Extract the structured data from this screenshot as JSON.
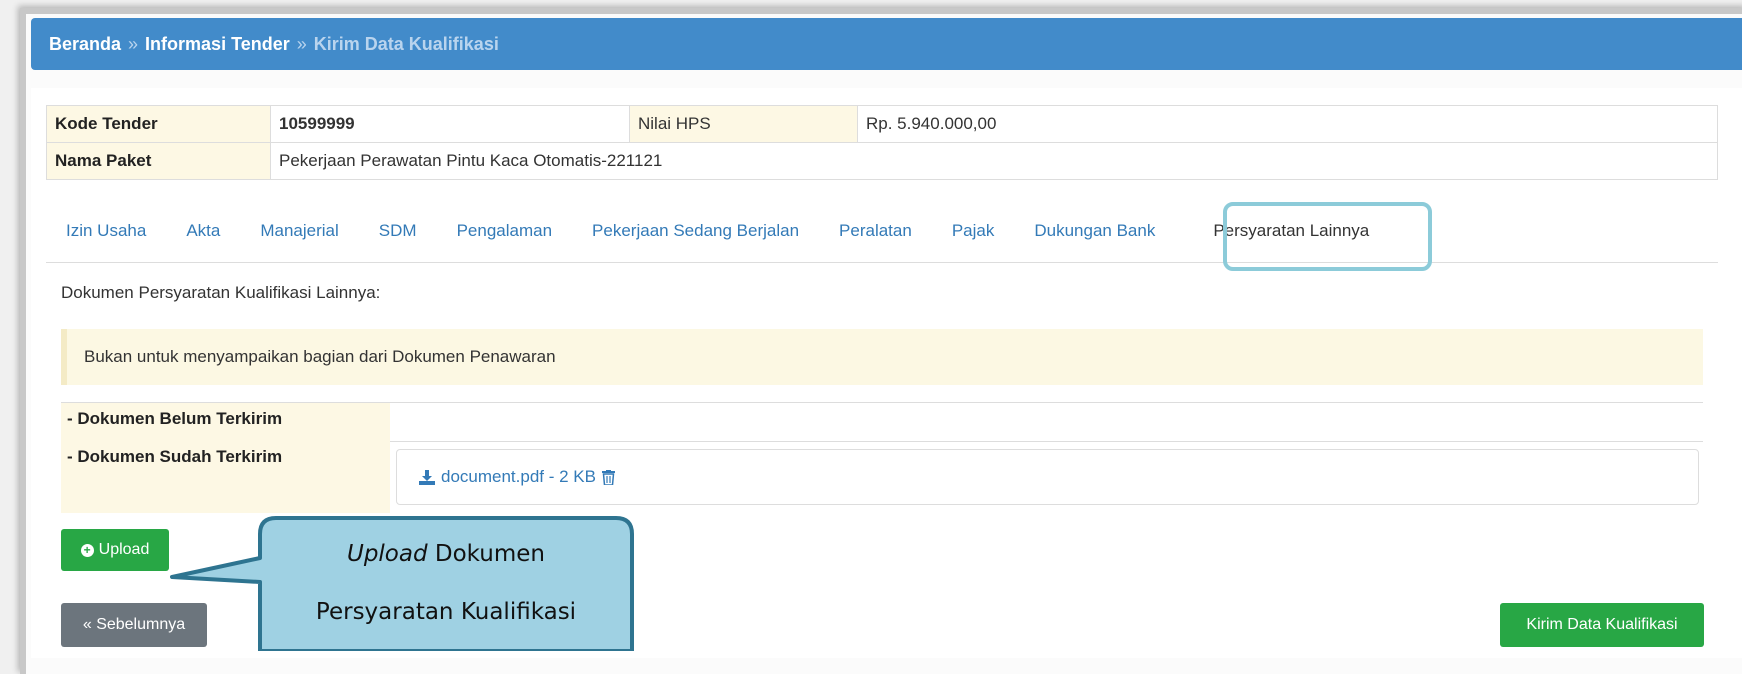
{
  "breadcrumb": {
    "home": "Beranda",
    "separator": "»",
    "info": "Informasi Tender",
    "current": "Kirim Data Kualifikasi"
  },
  "info_table": {
    "kode_label": "Kode Tender",
    "kode_value": "10599999",
    "hps_label": "Nilai HPS",
    "hps_value": "Rp. 5.940.000,00",
    "paket_label": "Nama Paket",
    "paket_value": "Pekerjaan Perawatan Pintu Kaca Otomatis-221121"
  },
  "tabs": [
    {
      "label": "Izin Usaha"
    },
    {
      "label": "Akta"
    },
    {
      "label": "Manajerial"
    },
    {
      "label": "SDM"
    },
    {
      "label": "Pengalaman"
    },
    {
      "label": "Pekerjaan Sedang Berjalan"
    },
    {
      "label": "Peralatan"
    },
    {
      "label": "Pajak"
    },
    {
      "label": "Dukungan Bank"
    },
    {
      "label": "Persyaratan Lainnya",
      "active": true
    }
  ],
  "content": {
    "heading": "Dokumen Persyaratan Kualifikasi Lainnya:",
    "alert": "Bukan untuk menyampaikan bagian dari Dokumen Penawaran",
    "belum_label": "- Dokumen Belum Terkirim",
    "sudah_label": "- Dokumen Sudah Terkirim",
    "file_link": "document.pdf - 2 KB"
  },
  "buttons": {
    "upload": "Upload",
    "prev": "« Sebelumnya",
    "kirim": "Kirim Data Kualifikasi"
  },
  "callout": {
    "line1_italic": "Upload",
    "line1_rest": " Dokumen",
    "line2": "Persyaratan Kualifikasi"
  },
  "colors": {
    "primary": "#428bca",
    "success": "#28a745",
    "secondary": "#6c757d",
    "callout_fill": "#9fd1e3",
    "callout_border": "#2e7490"
  },
  "icons": [
    "download-icon",
    "trash-icon",
    "plus-circle-icon"
  ]
}
